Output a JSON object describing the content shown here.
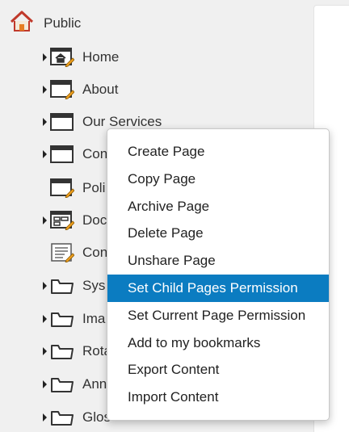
{
  "tree": {
    "root": {
      "label": "Public",
      "icon": "home-icon"
    },
    "nodes": [
      {
        "label": "Home",
        "icon": "home-page-icon",
        "caret": true
      },
      {
        "label": "About",
        "icon": "page-edit-icon",
        "caret": true
      },
      {
        "label": "Our Services",
        "icon": "page-icon",
        "caret": true
      },
      {
        "label": "Con",
        "icon": "page-icon",
        "caret": true
      },
      {
        "label": "Poli",
        "icon": "page-edit-icon",
        "caret": false
      },
      {
        "label": "Doc",
        "icon": "layout-edit-icon",
        "caret": true
      },
      {
        "label": "Con",
        "icon": "document-edit-icon",
        "caret": false
      },
      {
        "label": "Sys",
        "icon": "folder-icon",
        "caret": true
      },
      {
        "label": "Ima",
        "icon": "folder-icon",
        "caret": true
      },
      {
        "label": "Rota",
        "icon": "folder-icon",
        "caret": true
      },
      {
        "label": "Ann",
        "icon": "folder-icon",
        "caret": true
      },
      {
        "label": "Glos",
        "icon": "folder-icon",
        "caret": true
      }
    ]
  },
  "context_menu": {
    "items": [
      {
        "label": "Create Page"
      },
      {
        "label": "Copy Page"
      },
      {
        "label": "Archive Page"
      },
      {
        "label": "Delete Page"
      },
      {
        "label": "Unshare Page"
      },
      {
        "label": "Set Child Pages Permission",
        "active": true
      },
      {
        "label": "Set Current Page Permission"
      },
      {
        "label": "Add to my bookmarks"
      },
      {
        "label": "Export Content"
      },
      {
        "label": "Import Content"
      }
    ]
  },
  "colors": {
    "background": "#f0f0f0",
    "menu_highlight": "#0b7cc1",
    "house_roof": "#c0392b",
    "pencil": "#f0a020"
  }
}
